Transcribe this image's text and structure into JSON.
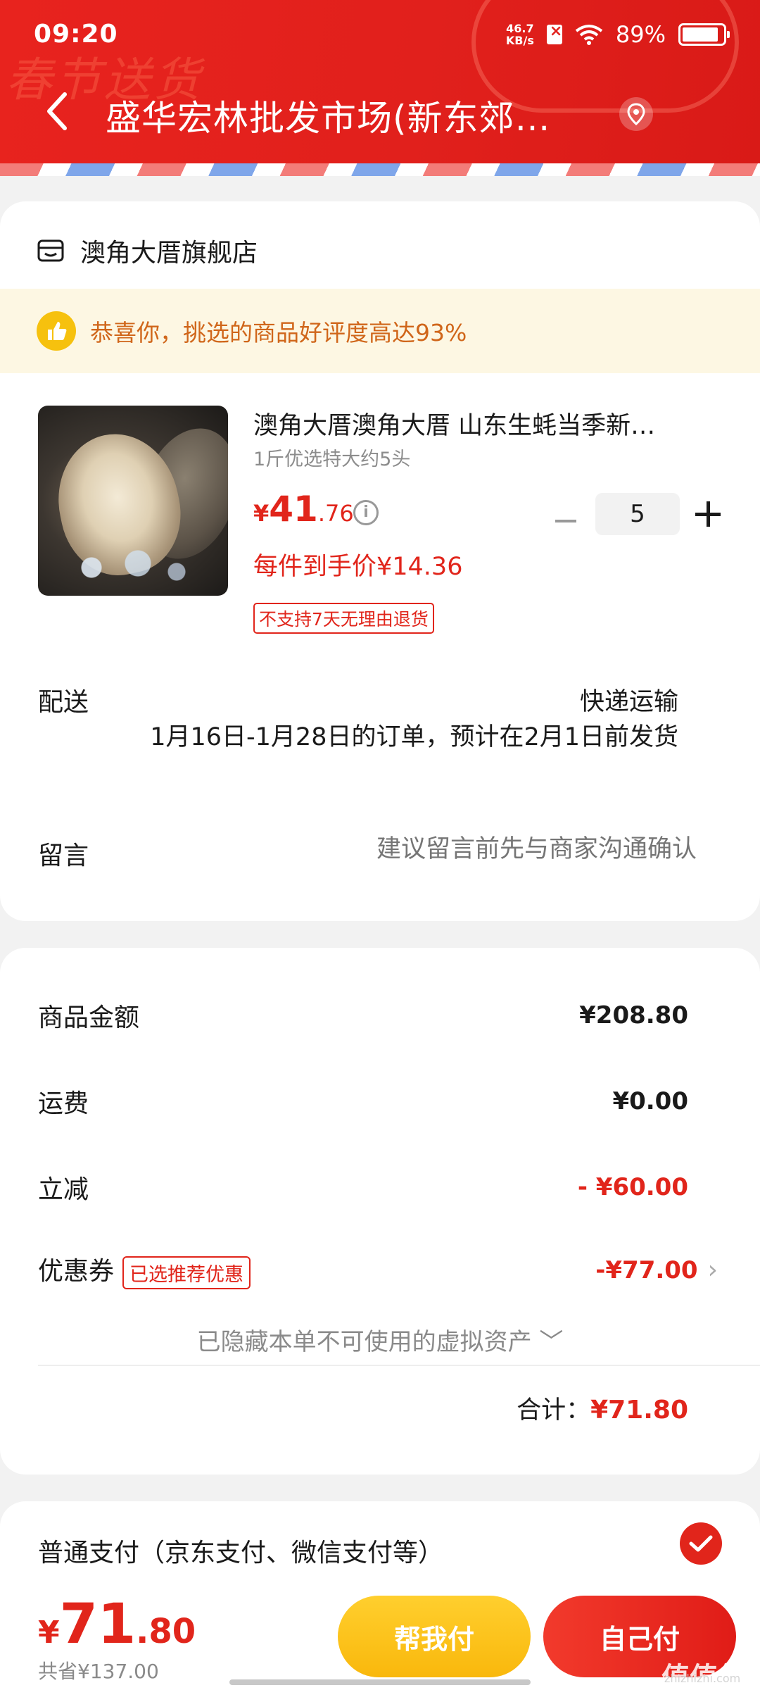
{
  "status_bar": {
    "time": "09:20",
    "net_speed_value": "46.7",
    "net_speed_unit": "KB/s",
    "battery": "89%"
  },
  "header": {
    "title": "盛华宏林批发市场(新东郊…",
    "banner_text": "春节送货"
  },
  "store": {
    "name": "澳角大厝旗舰店"
  },
  "tip": {
    "text": "恭喜你，挑选的商品好评度高达93%"
  },
  "product": {
    "title": "澳角大厝澳角大厝 山东生蚝当季新…",
    "spec": "1斤优选特大约5头",
    "price_currency": "¥",
    "price_int": "41",
    "price_dec": ".76",
    "unit_price": "每件到手价¥14.36",
    "return_tag": "不支持7天无理由退货",
    "quantity": "5"
  },
  "delivery": {
    "label": "配送",
    "method": "快递运输",
    "note": "1月16日-1月28日的订单，预计在2月1日前发货"
  },
  "message": {
    "label": "留言",
    "placeholder": "建议留言前先与商家沟通确认"
  },
  "summary": {
    "goods_label": "商品金额",
    "goods_value": "¥208.80",
    "shipping_label": "运费",
    "shipping_value": "¥0.00",
    "discount_label": "立减",
    "discount_value": "- ¥60.00",
    "coupon_label": "优惠券",
    "coupon_tag": "已选推荐优惠",
    "coupon_value": "-¥77.00",
    "hidden_assets": "已隐藏本单不可使用的虚拟资产 ﹀",
    "total_label": "合计：",
    "total_value": "¥71.80"
  },
  "payment": {
    "label": "普通支付（京东支付、微信支付等）"
  },
  "bottom": {
    "price_currency": "¥",
    "price_int": "71",
    "price_dec": ".80",
    "saved": "共省¥137.00",
    "help_pay": "帮我付",
    "self_pay": "自己付"
  },
  "watermark": {
    "text": "值值值",
    "sub": "zhizhizhi.com"
  },
  "colors": {
    "brand_red": "#e1251b",
    "header_red": "#e1201c",
    "tip_orange": "#d0661a",
    "help_yellow": "#f9b80c"
  },
  "icons": [
    "back-icon",
    "location-icon",
    "store-icon",
    "thumbs-up-icon",
    "info-icon",
    "minus-icon",
    "plus-icon",
    "chevron-right-icon",
    "check-icon",
    "wifi-icon",
    "battery-icon"
  ]
}
